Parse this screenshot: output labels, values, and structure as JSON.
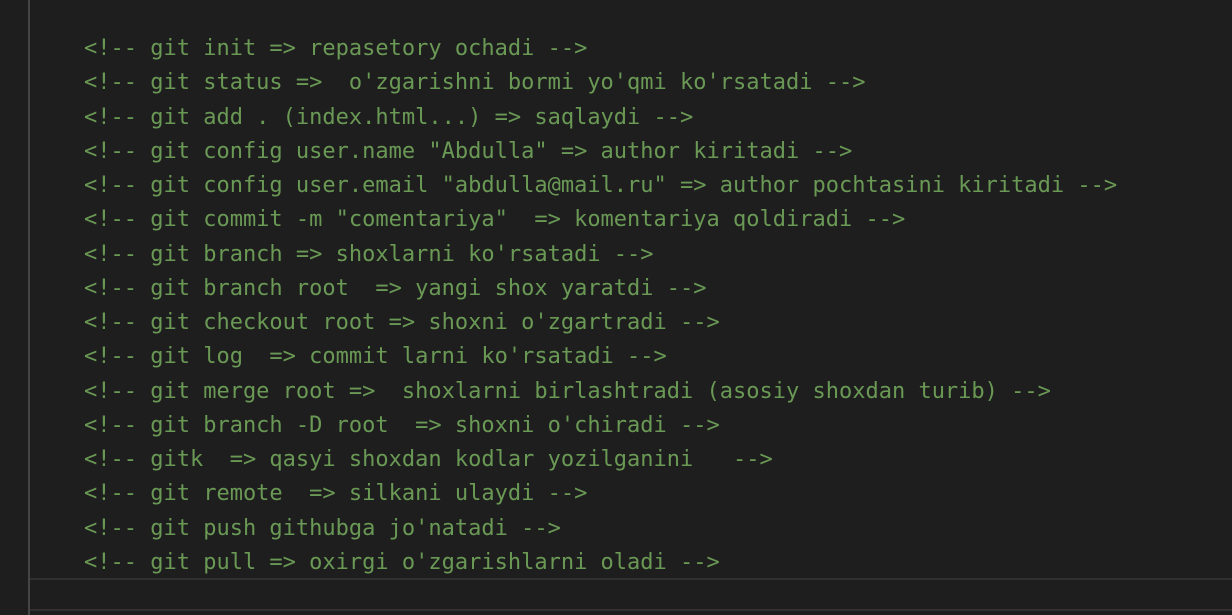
{
  "editor": {
    "lines": [
      "<!-- git init => repasetory ochadi -->",
      "<!-- git status =>  o'zgarishni bormi yo'qmi ko'rsatadi -->",
      "<!-- git add . (index.html...) => saqlaydi -->",
      "<!-- git config user.name \"Abdulla\" => author kiritadi -->",
      "<!-- git config user.email \"abdulla@mail.ru\" => author pochtasini kiritadi -->",
      "<!-- git commit -m \"comentariya\"  => komentariya qoldiradi -->",
      "<!-- git branch => shoxlarni ko'rsatadi -->",
      "<!-- git branch root  => yangi shox yaratdi -->",
      "<!-- git checkout root => shoxni o'zgartradi -->",
      "<!-- git log  => commit larni ko'rsatadi -->",
      "<!-- git merge root =>  shoxlarni birlashtradi (asosiy shoxdan turib) -->",
      "<!-- git branch -D root  => shoxni o'chiradi -->",
      "<!-- gitk  => qasyi shoxdan kodlar yozilganini   -->",
      "<!-- git remote  => silkani ulaydi -->",
      "<!-- git push githubga jo'natadi -->",
      "<!-- git pull => oxirgi o'zgarishlarni oladi -->"
    ],
    "colors": {
      "background": "#1e1e1e",
      "comment": "#6a9955",
      "indent_guide": "#454545",
      "current_line_border": "#303030"
    }
  }
}
